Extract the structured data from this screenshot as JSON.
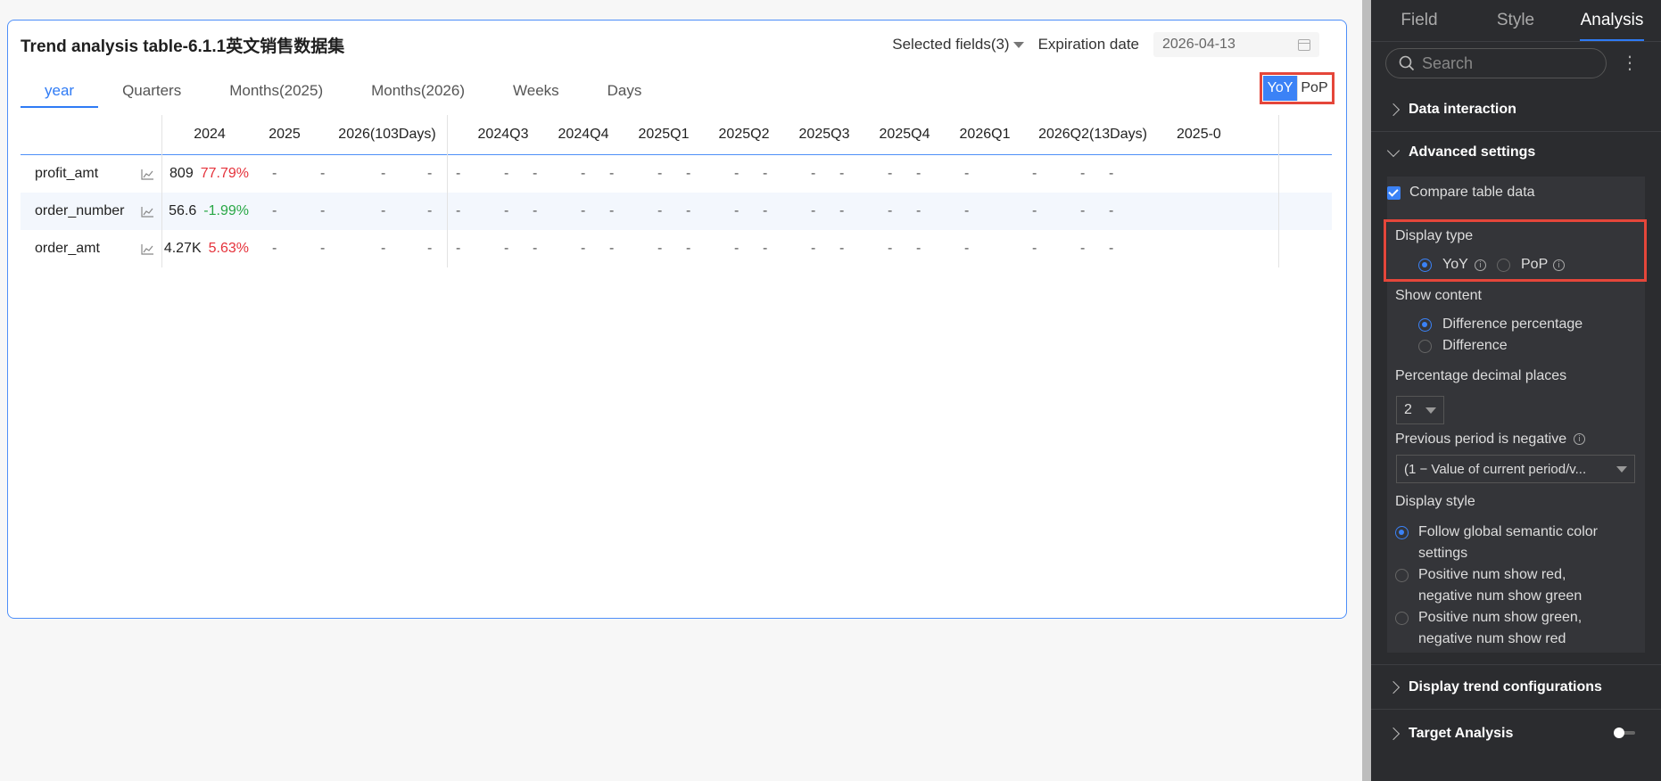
{
  "card": {
    "title": "Trend analysis table-6.1.1英文销售数据集",
    "selected_fields": "Selected fields(3)",
    "expiration_label": "Expiration date",
    "expiration_value": "2026-04-13"
  },
  "tabs": [
    "year",
    "Quarters",
    "Months(2025)",
    "Months(2026)",
    "Weeks",
    "Days"
  ],
  "compare_toggle": {
    "yoy": "YoY",
    "pop": "PoP"
  },
  "table": {
    "columns": [
      "2024",
      "2025",
      "2026(103Days)",
      "2024Q3",
      "2024Q4",
      "2025Q1",
      "2025Q2",
      "2025Q3",
      "2025Q4",
      "2026Q1",
      "2026Q2(13Days)",
      "2025-0"
    ],
    "rows": [
      {
        "name": "profit_amt",
        "value": "809",
        "pct": "77.79%"
      },
      {
        "name": "order_number",
        "value": "56.6",
        "pct": "-1.99%"
      },
      {
        "name": "order_amt",
        "value": "4.27K",
        "pct": "5.63%"
      }
    ],
    "empty": "-"
  },
  "panel": {
    "tabs": [
      "Field",
      "Style",
      "Analysis"
    ],
    "search_placeholder": "Search",
    "more": "⋮",
    "data_interaction": "Data interaction",
    "advanced_settings": "Advanced settings",
    "compare_table_data": "Compare table data",
    "display_type": "Display type",
    "display_type_yoy": "YoY",
    "display_type_pop": "PoP",
    "show_content": "Show content",
    "diff_percentage": "Difference percentage",
    "difference": "Difference",
    "pct_decimal": "Percentage decimal places",
    "pct_decimal_value": "2",
    "prev_negative": "Previous period is negative",
    "prev_negative_value": "(1 − Value of current period/v...",
    "display_style": "Display style",
    "style_opt1_l1": "Follow global semantic color",
    "style_opt1_l2": "settings",
    "style_opt2_l1": "Positive num show red,",
    "style_opt2_l2": "negative num show green",
    "style_opt3_l1": "Positive num show green,",
    "style_opt3_l2": "negative num show red",
    "display_trend": "Display trend configurations",
    "target_analysis": "Target Analysis"
  },
  "colors": {
    "accent": "#2f7bf5",
    "highlight": "#e5463a",
    "positive": "#e5323b",
    "negative": "#28a745"
  }
}
